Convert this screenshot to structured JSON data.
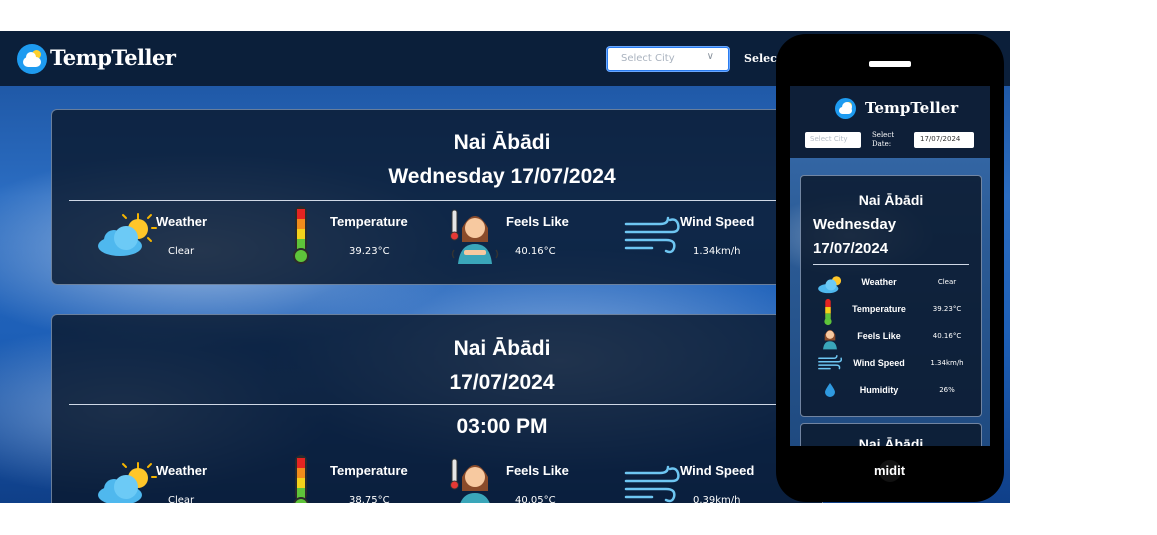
{
  "app": {
    "brand": "TempTeller",
    "city_placeholder": "Select City",
    "select_date_label": "Select D",
    "colors": {
      "header": "#0b1f3a",
      "card": "#0a192d",
      "logo_blue": "#1e9bf0",
      "sun": "#ffd02b"
    }
  },
  "current": {
    "city": "Nai Ābādi",
    "date_line": "Wednesday 17/07/2024",
    "metrics": [
      {
        "label": "Weather",
        "value": "Clear",
        "icon": "partly-cloudy-icon"
      },
      {
        "label": "Temperature",
        "value": "39.23°C",
        "icon": "thermometer-icon"
      },
      {
        "label": "Feels Like",
        "value": "40.16°C",
        "icon": "hot-person-icon"
      },
      {
        "label": "Wind Speed",
        "value": "1.34km/h",
        "icon": "wind-icon"
      }
    ]
  },
  "hourly": {
    "city": "Nai Ābādi",
    "date": "17/07/2024",
    "time": "03:00 PM",
    "metrics": [
      {
        "label": "Weather",
        "value": "Clear",
        "icon": "partly-cloudy-icon"
      },
      {
        "label": "Temperature",
        "value": "38.75°C",
        "icon": "thermometer-icon"
      },
      {
        "label": "Feels Like",
        "value": "40.05°C",
        "icon": "hot-person-icon"
      },
      {
        "label": "Wind Speed",
        "value": "0.39km/h",
        "icon": "wind-icon"
      }
    ]
  },
  "mobile": {
    "brand": "TempTeller",
    "city_placeholder": "Select City",
    "select_date_label": "Select Date:",
    "date_value": "17/07/2024",
    "card": {
      "city": "Nai Ābādi",
      "day": "Wednesday",
      "date": "17/07/2024",
      "rows": [
        {
          "label": "Weather",
          "value": "Clear",
          "icon": "partly-cloudy-icon"
        },
        {
          "label": "Temperature",
          "value": "39.23°C",
          "icon": "thermometer-icon"
        },
        {
          "label": "Feels Like",
          "value": "40.16°C",
          "icon": "hot-person-icon"
        },
        {
          "label": "Wind Speed",
          "value": "1.34km/h",
          "icon": "wind-icon"
        },
        {
          "label": "Humidity",
          "value": "26%",
          "icon": "water-drop-icon"
        }
      ]
    },
    "next_card_title": "Nai Ābādi",
    "overflow_text": "midit"
  }
}
